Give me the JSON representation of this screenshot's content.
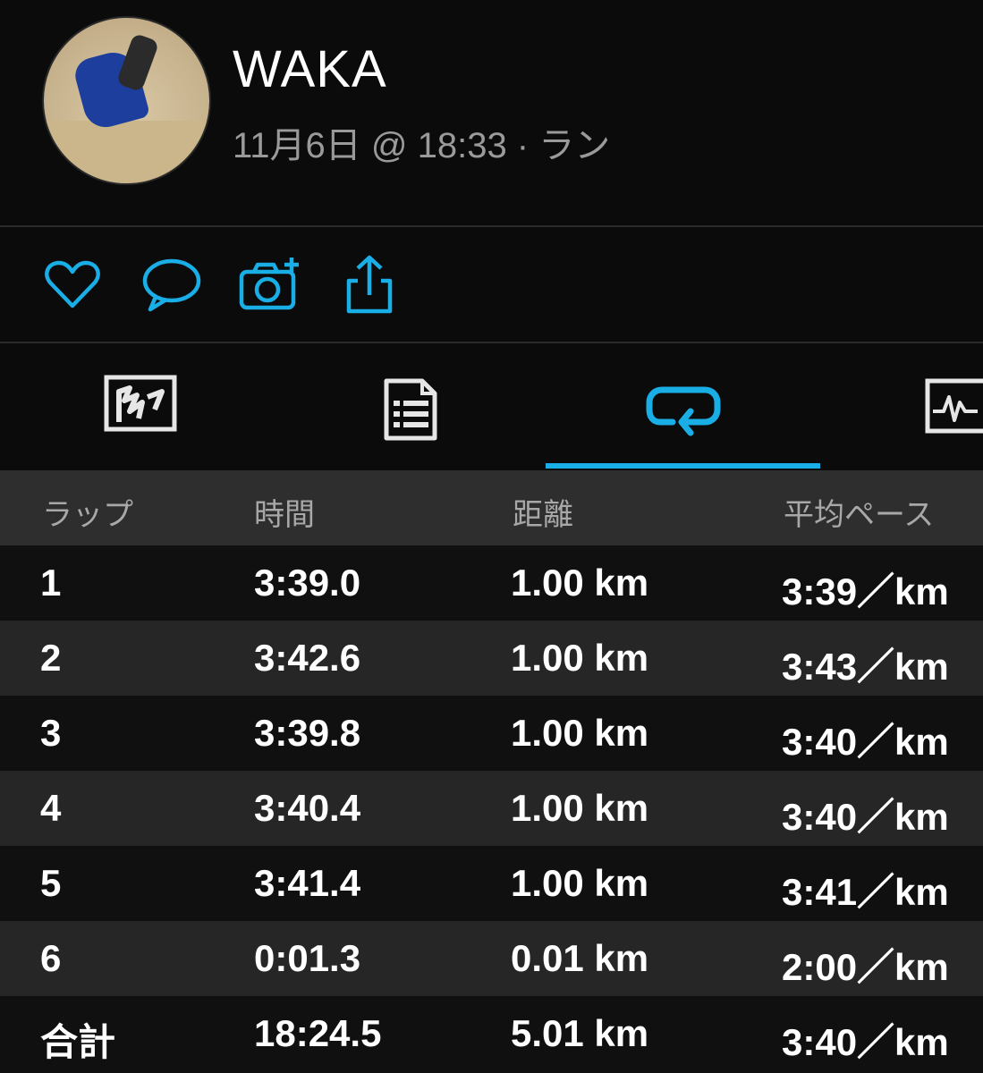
{
  "profile": {
    "name": "WAKA",
    "subtitle": "11月6日 @ 18:33 · ラン"
  },
  "actions": {
    "icons": [
      "heart-icon",
      "comment-icon",
      "add-photo-icon",
      "share-icon"
    ],
    "accent": "#1aaee6"
  },
  "tabs": {
    "items": [
      "map-icon",
      "details-icon",
      "laps-icon",
      "charts-icon"
    ],
    "active_index": 2
  },
  "table": {
    "headers": {
      "lap": "ラップ",
      "time": "時間",
      "distance": "距離",
      "pace": "平均ペース"
    },
    "rows": [
      {
        "lap": "1",
        "time": "3:39.0",
        "distance": "1.00 km",
        "pace": "3:39／km"
      },
      {
        "lap": "2",
        "time": "3:42.6",
        "distance": "1.00 km",
        "pace": "3:43／km"
      },
      {
        "lap": "3",
        "time": "3:39.8",
        "distance": "1.00 km",
        "pace": "3:40／km"
      },
      {
        "lap": "4",
        "time": "3:40.4",
        "distance": "1.00 km",
        "pace": "3:40／km"
      },
      {
        "lap": "5",
        "time": "3:41.4",
        "distance": "1.00 km",
        "pace": "3:41／km"
      },
      {
        "lap": "6",
        "time": "0:01.3",
        "distance": "0.01 km",
        "pace": "2:00／km"
      }
    ],
    "total": {
      "lap": "合計",
      "time": "18:24.5",
      "distance": "5.01 km",
      "pace": "3:40／km"
    }
  }
}
